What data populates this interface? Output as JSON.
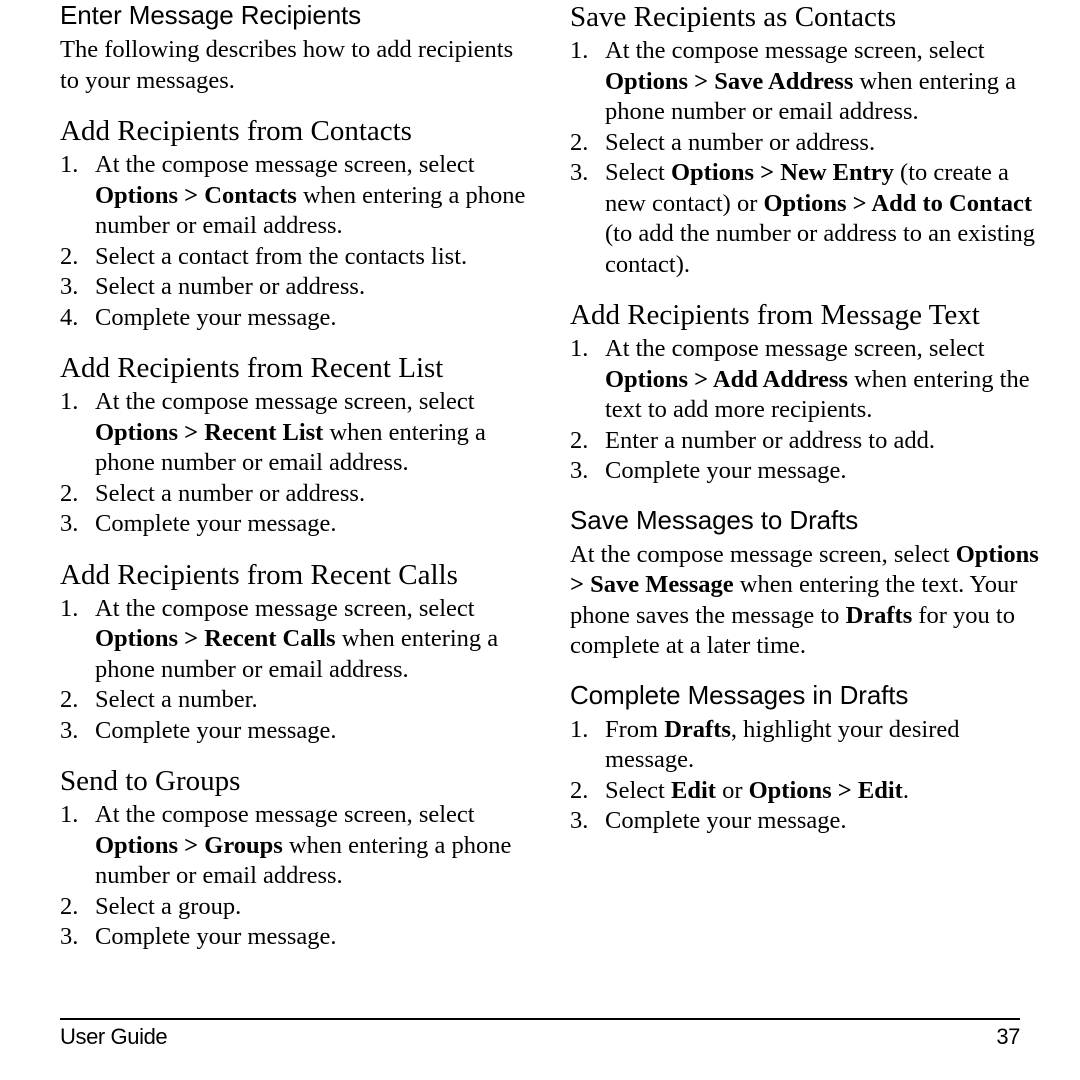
{
  "page": {
    "number": "37",
    "footer_left": "User Guide"
  },
  "left_column": {
    "sections": [
      {
        "id": "enter-message-recipients",
        "heading": "Enter Message Recipients",
        "heading_style": "sans",
        "paragraph": "The following describes how to add recipients to your messages."
      },
      {
        "id": "add-recipients-from-contacts",
        "heading": "Add Recipients from Contacts",
        "heading_style": "serif",
        "steps": [
          {
            "parts": [
              {
                "text": "At the compose message screen, select ",
                "bold": false
              },
              {
                "text": "Options > Contacts",
                "bold": true
              },
              {
                "text": " when entering a phone number or email address.",
                "bold": false
              }
            ]
          },
          {
            "parts": [
              {
                "text": "Select a contact from the contacts list.",
                "bold": false
              }
            ]
          },
          {
            "parts": [
              {
                "text": "Select a number or address.",
                "bold": false
              }
            ]
          },
          {
            "parts": [
              {
                "text": "Complete your message.",
                "bold": false
              }
            ]
          }
        ]
      },
      {
        "id": "add-recipients-from-recent-list",
        "heading": "Add Recipients from Recent List",
        "heading_style": "serif",
        "steps": [
          {
            "parts": [
              {
                "text": "At the compose message screen, select ",
                "bold": false
              },
              {
                "text": "Options > Recent List",
                "bold": true
              },
              {
                "text": " when entering a phone number or email address.",
                "bold": false
              }
            ]
          },
          {
            "parts": [
              {
                "text": "Select a number or address.",
                "bold": false
              }
            ]
          },
          {
            "parts": [
              {
                "text": "Complete your message.",
                "bold": false
              }
            ]
          }
        ]
      },
      {
        "id": "add-recipients-from-recent-calls",
        "heading": "Add Recipients from Recent Calls",
        "heading_style": "serif",
        "steps": [
          {
            "parts": [
              {
                "text": "At the compose message screen, select ",
                "bold": false
              },
              {
                "text": "Options > Recent Calls",
                "bold": true
              },
              {
                "text": " when entering a phone number or email address.",
                "bold": false
              }
            ]
          },
          {
            "parts": [
              {
                "text": "Select a number.",
                "bold": false
              }
            ]
          },
          {
            "parts": [
              {
                "text": "Complete your message.",
                "bold": false
              }
            ]
          }
        ]
      },
      {
        "id": "send-to-groups",
        "heading": "Send to Groups",
        "heading_style": "serif",
        "steps": [
          {
            "parts": [
              {
                "text": "At the compose message screen, select ",
                "bold": false
              },
              {
                "text": "Options > Groups",
                "bold": true
              },
              {
                "text": " when entering a phone number or email address.",
                "bold": false
              }
            ]
          },
          {
            "parts": [
              {
                "text": "Select a group.",
                "bold": false
              }
            ]
          },
          {
            "parts": [
              {
                "text": "Complete your message.",
                "bold": false
              }
            ]
          }
        ]
      }
    ]
  },
  "right_column": {
    "sections": [
      {
        "id": "save-recipients-as-contacts",
        "heading": "Save Recipients as Contacts",
        "heading_style": "serif",
        "steps": [
          {
            "parts": [
              {
                "text": "At the compose message screen, select ",
                "bold": false
              },
              {
                "text": "Options > Save Address",
                "bold": true
              },
              {
                "text": " when entering a phone number or email address.",
                "bold": false
              }
            ]
          },
          {
            "parts": [
              {
                "text": "Select a number or address.",
                "bold": false
              }
            ]
          },
          {
            "parts": [
              {
                "text": "Select ",
                "bold": false
              },
              {
                "text": "Options > New Entry",
                "bold": true
              },
              {
                "text": " (to create a new contact) or ",
                "bold": false
              },
              {
                "text": "Options > Add to Contact",
                "bold": true
              },
              {
                "text": " (to add the number or address to an existing contact).",
                "bold": false
              }
            ]
          }
        ]
      },
      {
        "id": "add-recipients-from-message-text",
        "heading": "Add Recipients from Message Text",
        "heading_style": "serif",
        "steps": [
          {
            "parts": [
              {
                "text": "At the compose message screen, select ",
                "bold": false
              },
              {
                "text": "Options > Add Address",
                "bold": true
              },
              {
                "text": " when entering the text to add more recipients.",
                "bold": false
              }
            ]
          },
          {
            "parts": [
              {
                "text": "Enter a number or address to add.",
                "bold": false
              }
            ]
          },
          {
            "parts": [
              {
                "text": "Complete your message.",
                "bold": false
              }
            ]
          }
        ]
      },
      {
        "id": "save-messages-to-drafts",
        "heading": "Save Messages to Drafts",
        "heading_style": "sans",
        "rich_paragraph": [
          {
            "text": "At the compose message screen, select ",
            "bold": false
          },
          {
            "text": "Options > Save Message",
            "bold": true
          },
          {
            "text": " when entering the text. Your phone saves the message to ",
            "bold": false
          },
          {
            "text": "Drafts",
            "bold": true
          },
          {
            "text": " for you to complete at a later time.",
            "bold": false
          }
        ]
      },
      {
        "id": "complete-messages-in-drafts",
        "heading": "Complete Messages in Drafts",
        "heading_style": "sans",
        "steps": [
          {
            "parts": [
              {
                "text": "From ",
                "bold": false
              },
              {
                "text": "Drafts",
                "bold": true
              },
              {
                "text": ", highlight your desired message.",
                "bold": false
              }
            ]
          },
          {
            "parts": [
              {
                "text": "Select ",
                "bold": false
              },
              {
                "text": "Edit",
                "bold": true
              },
              {
                "text": " or ",
                "bold": false
              },
              {
                "text": "Options > Edit",
                "bold": true
              },
              {
                "text": ".",
                "bold": false
              }
            ]
          },
          {
            "parts": [
              {
                "text": "Complete your message.",
                "bold": false
              }
            ]
          }
        ]
      }
    ]
  }
}
